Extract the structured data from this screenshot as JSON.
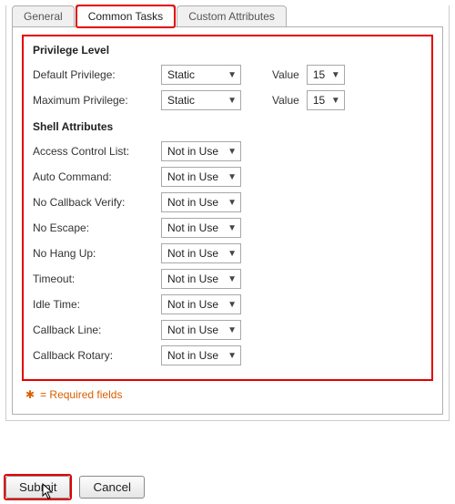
{
  "tabs": {
    "general": "General",
    "common_tasks": "Common Tasks",
    "custom_attributes": "Custom Attributes"
  },
  "sections": {
    "privilege_level": "Privilege Level",
    "shell_attributes": "Shell Attributes"
  },
  "labels": {
    "default_privilege": "Default Privilege:",
    "maximum_privilege": "Maximum Privilege:",
    "value": "Value",
    "acl": "Access Control List:",
    "auto_command": "Auto Command:",
    "no_callback_verify": "No Callback Verify:",
    "no_escape": "No Escape:",
    "no_hang_up": "No Hang Up:",
    "timeout": "Timeout:",
    "idle_time": "Idle Time:",
    "callback_line": "Callback Line:",
    "callback_rotary": "Callback Rotary:"
  },
  "values": {
    "static": "Static",
    "not_in_use": "Not in Use",
    "fifteen": "15"
  },
  "footer": {
    "required_note": "= Required fields"
  },
  "buttons": {
    "submit": "Submit",
    "cancel": "Cancel"
  }
}
